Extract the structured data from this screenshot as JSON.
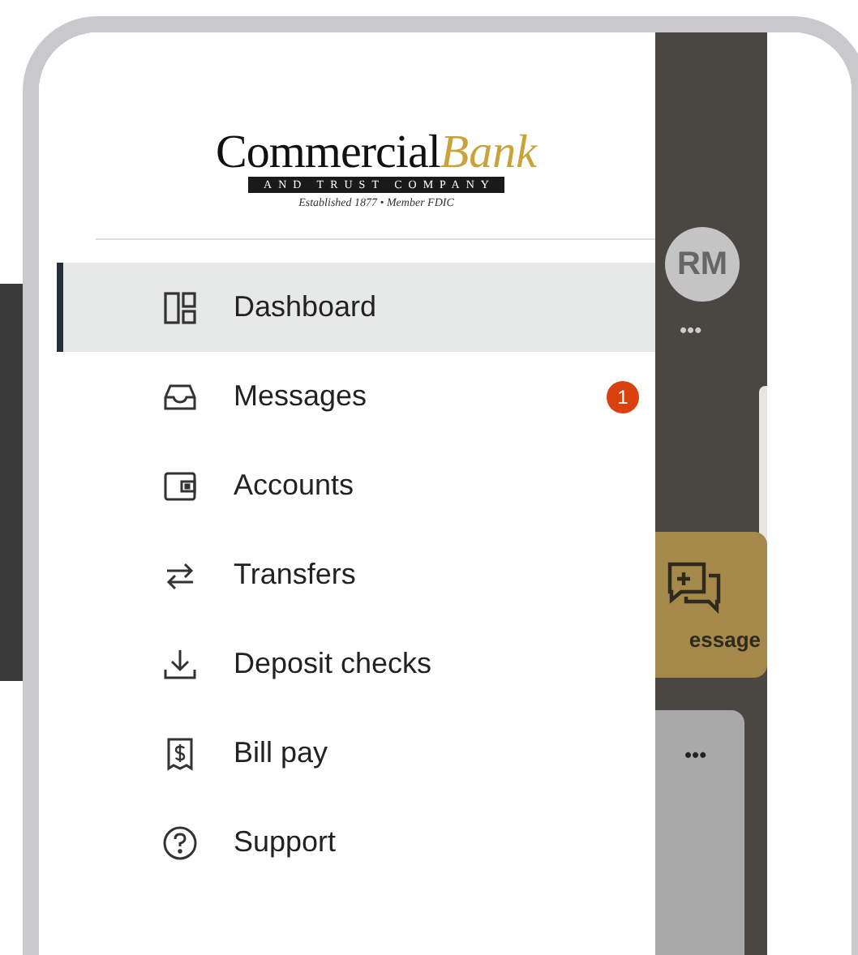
{
  "logo": {
    "name": "Commercial",
    "accent": "Bank",
    "banner": "AND TRUST COMPANY",
    "tagline": "Established 1877 • Member FDIC"
  },
  "menu": [
    {
      "label": "Dashboard",
      "selected": true
    },
    {
      "label": "Messages",
      "selected": false,
      "badge": "1"
    },
    {
      "label": "Accounts",
      "selected": false
    },
    {
      "label": "Transfers",
      "selected": false
    },
    {
      "label": "Deposit checks",
      "selected": false
    },
    {
      "label": "Bill pay",
      "selected": false
    },
    {
      "label": "Support",
      "selected": false
    }
  ],
  "background": {
    "avatar": "RM",
    "more_top": "•••",
    "action_label": "essage",
    "more_bottom": "•••"
  }
}
